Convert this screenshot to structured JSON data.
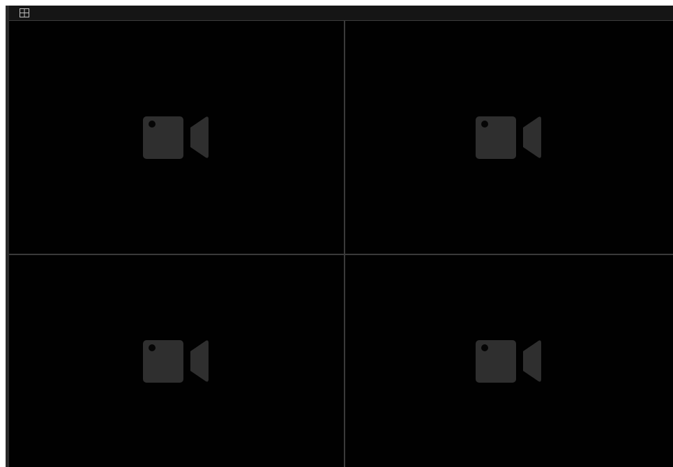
{
  "toolbar": {
    "layout_button_icon": "grid-2x2-icon"
  },
  "video_grid": {
    "layout": "2x2",
    "tiles": [
      {
        "state": "no-signal",
        "icon": "video-camera-icon"
      },
      {
        "state": "no-signal",
        "icon": "video-camera-icon"
      },
      {
        "state": "no-signal",
        "icon": "video-camera-icon"
      },
      {
        "state": "no-signal",
        "icon": "video-camera-icon"
      }
    ]
  },
  "colors": {
    "background": "#000000",
    "toolbar": "#151515",
    "divider": "#3a3a3a",
    "placeholder_icon": "#2f2f2f",
    "placeholder_dot": "#050505",
    "layout_icon": "#bfbfbf"
  }
}
